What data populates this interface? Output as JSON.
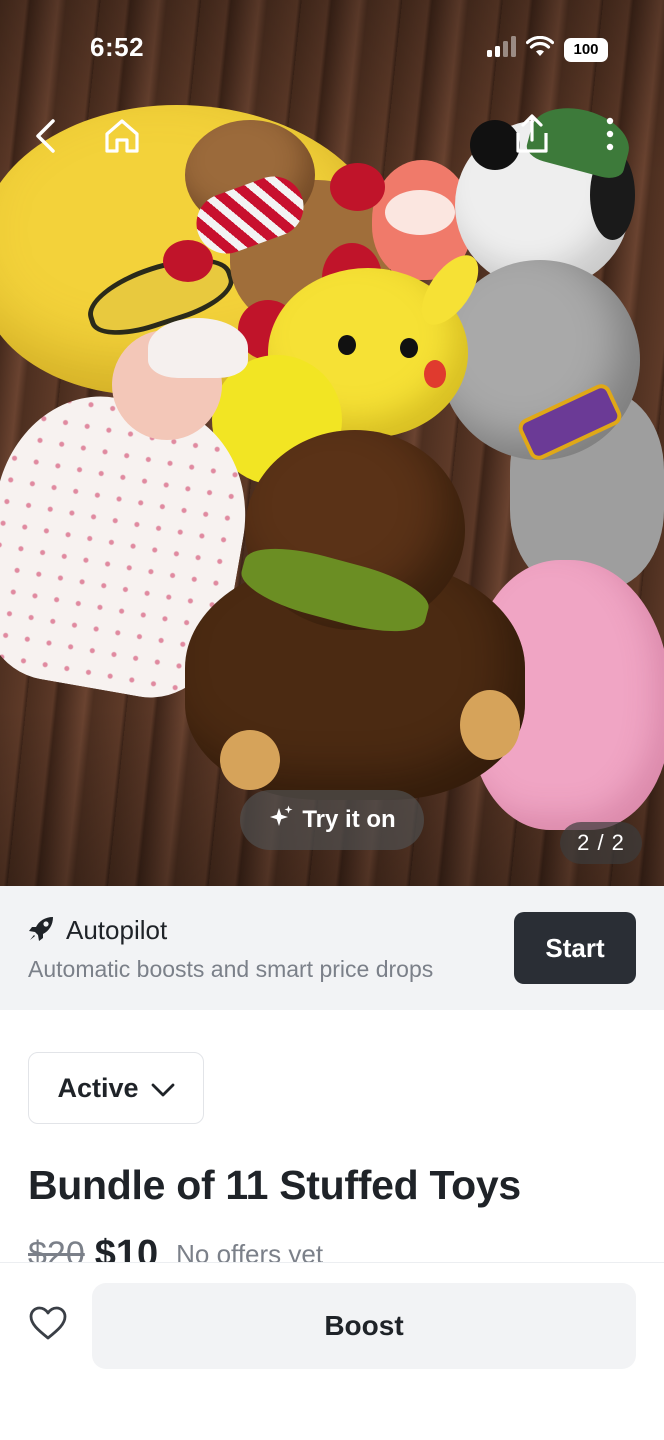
{
  "status_bar": {
    "time": "6:52",
    "battery": "100"
  },
  "photo": {
    "try_on_label": "Try it on",
    "counter": "2 / 2"
  },
  "autopilot": {
    "title": "Autopilot",
    "subtitle": "Automatic boosts and smart price drops",
    "start_label": "Start"
  },
  "listing": {
    "status": "Active",
    "title": "Bundle of 11 Stuffed Toys",
    "original_price": "$20",
    "price": "$10",
    "offers": "No offers yet"
  },
  "bottom": {
    "boost_label": "Boost"
  },
  "colors": {
    "primary_dark": "#2a2e35",
    "muted_text": "#7b8089",
    "banner_bg": "#f2f3f5"
  },
  "icons": [
    "back-icon",
    "home-icon",
    "share-icon",
    "more-icon",
    "sparkle-icon",
    "rocket-icon",
    "chevron-down-icon",
    "heart-icon",
    "wifi-icon",
    "signal-icon"
  ]
}
